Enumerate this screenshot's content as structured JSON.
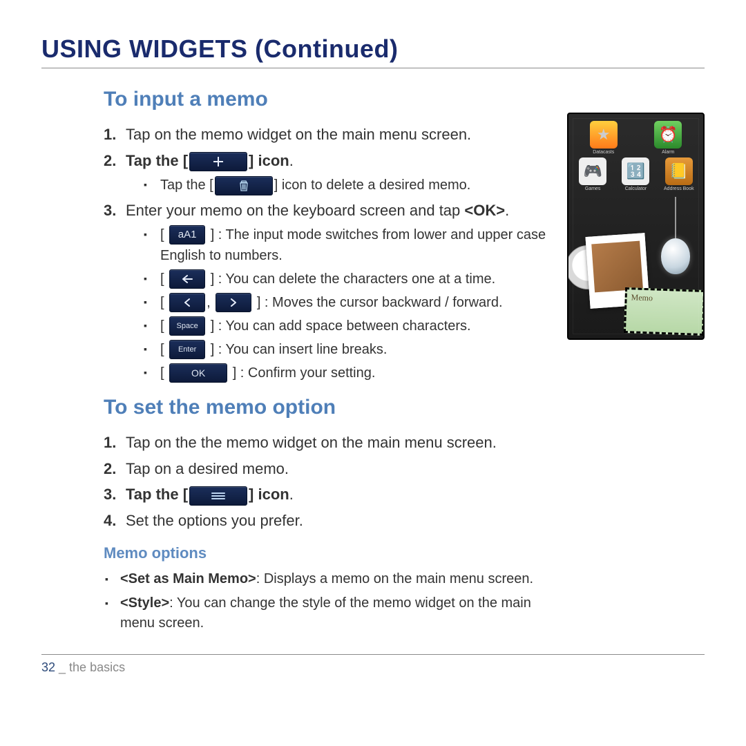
{
  "heading": "USING WIDGETS (Continued)",
  "section1": {
    "title": "To input a memo",
    "steps": {
      "s1": "Tap on the memo widget on the main menu screen.",
      "s2_pre": "Tap the [",
      "s2_post": "] icon",
      "s2_period": ".",
      "s2_sub_pre": "Tap the [",
      "s2_sub_post": "] icon to delete a desired memo.",
      "s3_a": "Enter your memo on the keyboard screen and tap ",
      "s3_b": "<OK>",
      "s3_c": ".",
      "kb": {
        "aA1": "] : The input mode switches from lower and upper case English to numbers.",
        "back": "] : You can delete the characters one at a time.",
        "cursors_mid": ",",
        "cursors_post": "] : Moves the cursor backward / forward.",
        "space": "] : You can add space between characters.",
        "enter": "] : You can insert line breaks.",
        "ok": "] : Confirm your setting."
      }
    }
  },
  "section2": {
    "title": "To set the memo option",
    "steps": {
      "s1": "Tap on the the memo widget on the main menu screen.",
      "s2": "Tap on a desired memo.",
      "s3_pre": "Tap the [",
      "s3_post": "] icon",
      "s3_period": ".",
      "s4": "Set the options you prefer."
    },
    "opts_title": "Memo options",
    "opts": {
      "o1_b": "<Set as Main Memo>",
      "o1_t": ": Displays a memo on the main menu screen.",
      "o2_b": "<Style>",
      "o2_t": ": You can change the style of the memo widget on the main menu screen."
    }
  },
  "buttons": {
    "plus": "✚",
    "trash": "trash",
    "aA1": "aA1",
    "left": "←",
    "lt": "<",
    "gt": ">",
    "space": "Space",
    "enter": "Enter",
    "ok": "OK",
    "menu": "≡"
  },
  "device": {
    "apps": {
      "datacasts": "Datacasts",
      "alarm": "Alarm",
      "games": "Games",
      "calculator": "Calculator",
      "addressbook": "Address Book"
    },
    "memo_label": "Memo"
  },
  "footer": {
    "page": "32",
    "sep": " _ ",
    "section": "the basics"
  },
  "bracket_open": "["
}
